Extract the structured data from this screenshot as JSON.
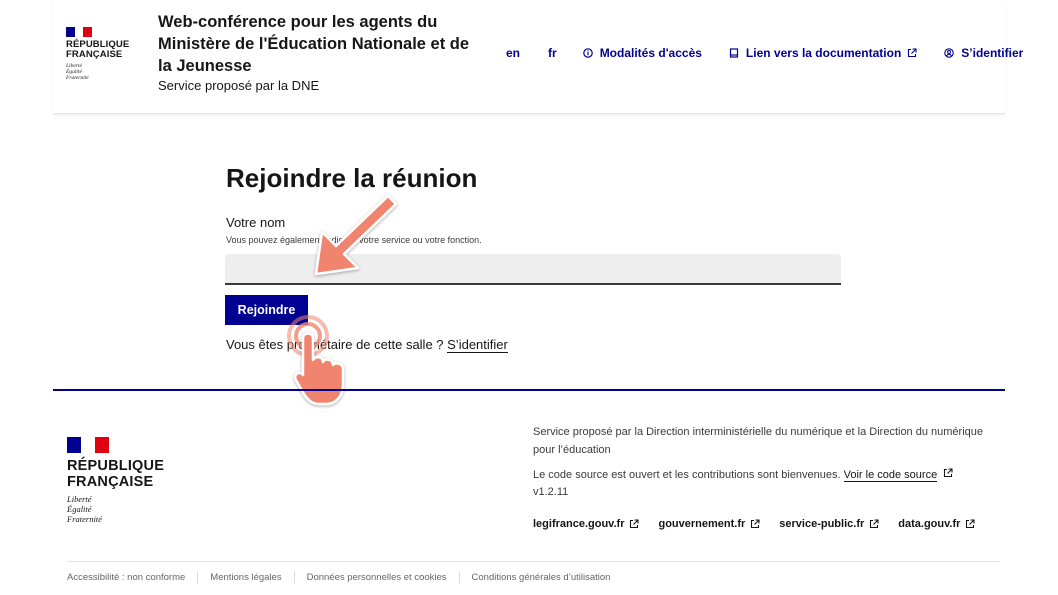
{
  "brand": {
    "republique": [
      "RÉPUBLIQUE",
      "FRANÇAISE"
    ],
    "motto": [
      "Liberté",
      "Égalité",
      "Fraternité"
    ],
    "flag_colors": [
      "#000091",
      "#ffffff",
      "#e1000f"
    ]
  },
  "header": {
    "title": "Web-conférence pour les agents du Ministère de l'Éducation Nationale et de la Jeunesse",
    "tagline": "Service proposé par la DNE",
    "languages": [
      "en",
      "fr"
    ],
    "links": {
      "access": "Modalités d'accès",
      "docs": "Lien vers la documentation",
      "login": "S’identifier"
    }
  },
  "main": {
    "title": "Rejoindre la réunion",
    "field_label": "Votre nom",
    "field_hint": "Vous pouvez également indiquer votre service ou votre fonction.",
    "field_value": "",
    "join_label": "Rejoindre",
    "owner_text": "Vous êtes propriétaire de cette salle ? ",
    "owner_link": "S’identifier"
  },
  "footer": {
    "desc1": "Service proposé par la Direction interministérielle du numérique et la Direction du numérique pour l’éducation",
    "desc2": "Le code source est ouvert et les contributions sont bienvenues. ",
    "source_link": "Voir le code source",
    "version": "v1.2.11",
    "links": [
      "legifrance.gouv.fr",
      "gouvernement.fr",
      "service-public.fr",
      "data.gouv.fr"
    ],
    "bottom": [
      "Accessibilité : non conforme",
      "Mentions légales",
      "Données personnelles et cookies",
      "Conditions générales d’utilisation"
    ]
  },
  "colors": {
    "accent": "#000091",
    "annotation": "#f0846e"
  }
}
